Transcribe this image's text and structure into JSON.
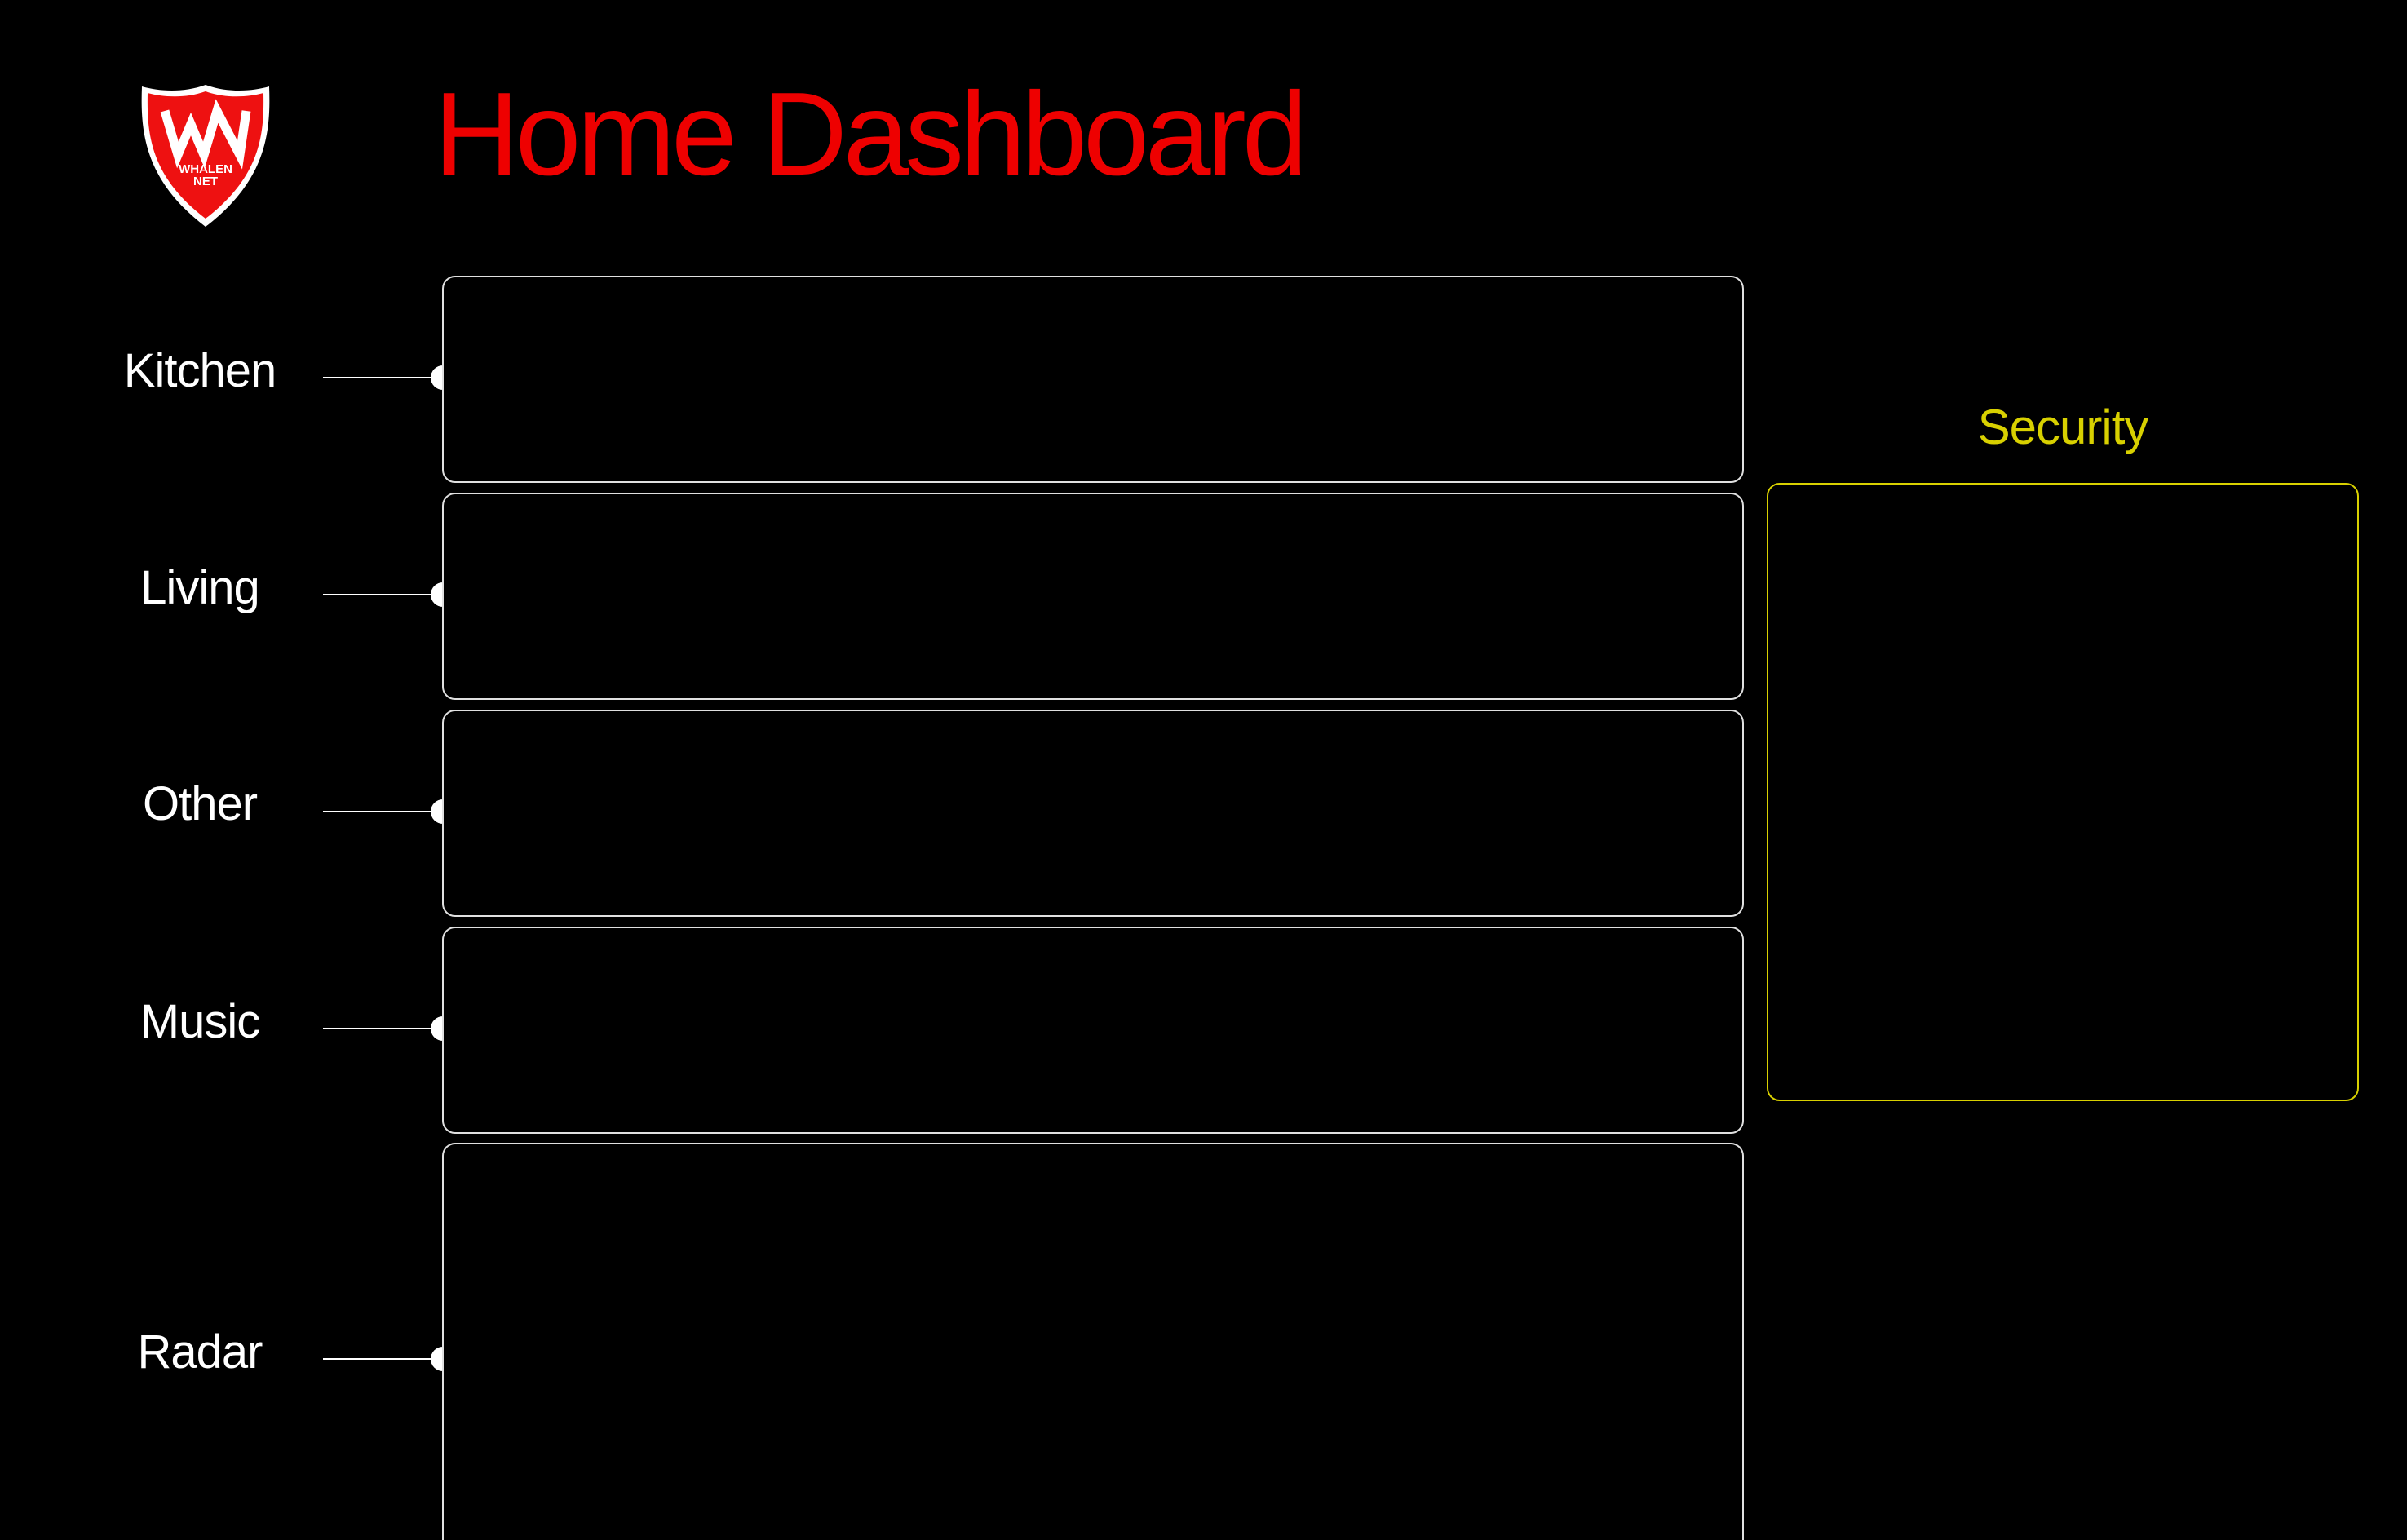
{
  "header": {
    "logo_name": "shield-logo",
    "logo_text": [
      "WHALEN",
      "NET"
    ],
    "title": "Home Dashboard"
  },
  "colors": {
    "title": "#ee0000",
    "logo_red": "#ee1111",
    "panel_border": "#e0e0e0",
    "security": "#d8d000",
    "background": "#000000"
  },
  "rooms": [
    {
      "label": "Kitchen"
    },
    {
      "label": "Living"
    },
    {
      "label": "Other"
    },
    {
      "label": "Music"
    },
    {
      "label": "Radar"
    }
  ],
  "security": {
    "title": "Security"
  }
}
